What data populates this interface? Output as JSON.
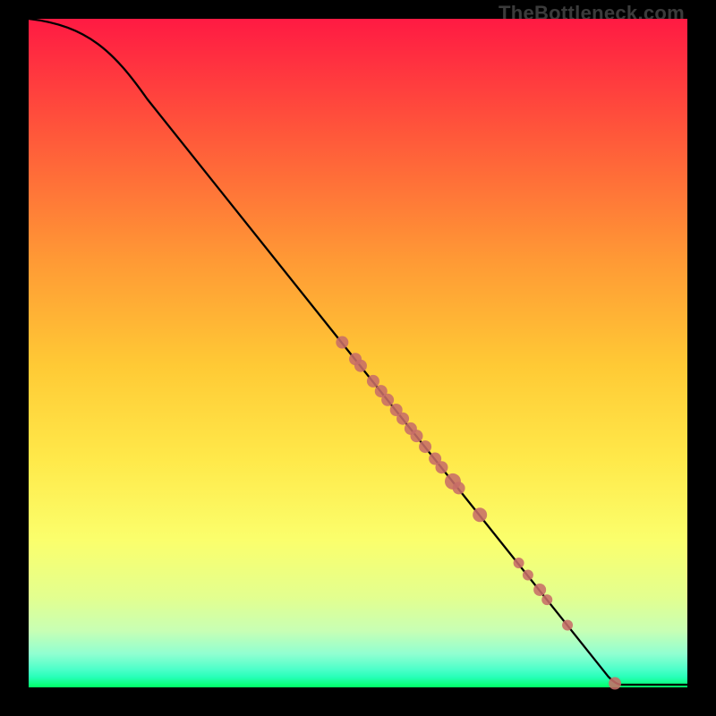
{
  "watermark": "TheBottleneck.com",
  "colors": {
    "frame": "#000000",
    "curve": "#000000",
    "point": "#c76d68",
    "gradient_top": "#ff1a43",
    "gradient_bottom": "#00ff66"
  },
  "chart_data": {
    "type": "line",
    "title": "",
    "xlabel": "",
    "ylabel": "",
    "xlim": [
      0,
      100
    ],
    "ylim": [
      0,
      100
    ],
    "curve": [
      {
        "x": 0,
        "y": 100
      },
      {
        "x": 4,
        "y": 99.2
      },
      {
        "x": 8,
        "y": 97.6
      },
      {
        "x": 12,
        "y": 94.6
      },
      {
        "x": 16,
        "y": 90.3
      },
      {
        "x": 20,
        "y": 85.5
      },
      {
        "x": 30,
        "y": 73.2
      },
      {
        "x": 40,
        "y": 60.8
      },
      {
        "x": 50,
        "y": 48.5
      },
      {
        "x": 60,
        "y": 36.2
      },
      {
        "x": 70,
        "y": 23.8
      },
      {
        "x": 80,
        "y": 11.5
      },
      {
        "x": 88,
        "y": 1.6
      },
      {
        "x": 89.2,
        "y": 0.4
      },
      {
        "x": 100,
        "y": 0.4
      }
    ],
    "points": [
      {
        "x": 47.6,
        "y": 51.6,
        "r": 7
      },
      {
        "x": 49.6,
        "y": 49.1,
        "r": 7
      },
      {
        "x": 50.4,
        "y": 48.1,
        "r": 7
      },
      {
        "x": 52.3,
        "y": 45.8,
        "r": 7
      },
      {
        "x": 53.5,
        "y": 44.3,
        "r": 7
      },
      {
        "x": 54.5,
        "y": 43.0,
        "r": 7
      },
      {
        "x": 55.8,
        "y": 41.5,
        "r": 7
      },
      {
        "x": 56.8,
        "y": 40.2,
        "r": 7
      },
      {
        "x": 58.0,
        "y": 38.7,
        "r": 7
      },
      {
        "x": 58.9,
        "y": 37.6,
        "r": 7
      },
      {
        "x": 60.2,
        "y": 36.0,
        "r": 7
      },
      {
        "x": 61.7,
        "y": 34.2,
        "r": 7
      },
      {
        "x": 62.7,
        "y": 32.9,
        "r": 7
      },
      {
        "x": 64.4,
        "y": 30.8,
        "r": 9
      },
      {
        "x": 65.3,
        "y": 29.8,
        "r": 7
      },
      {
        "x": 68.5,
        "y": 25.8,
        "r": 8
      },
      {
        "x": 74.4,
        "y": 18.6,
        "r": 6
      },
      {
        "x": 75.8,
        "y": 16.8,
        "r": 6
      },
      {
        "x": 77.6,
        "y": 14.6,
        "r": 7
      },
      {
        "x": 78.7,
        "y": 13.1,
        "r": 6
      },
      {
        "x": 81.8,
        "y": 9.3,
        "r": 6
      },
      {
        "x": 89.0,
        "y": 0.6,
        "r": 7
      }
    ]
  }
}
